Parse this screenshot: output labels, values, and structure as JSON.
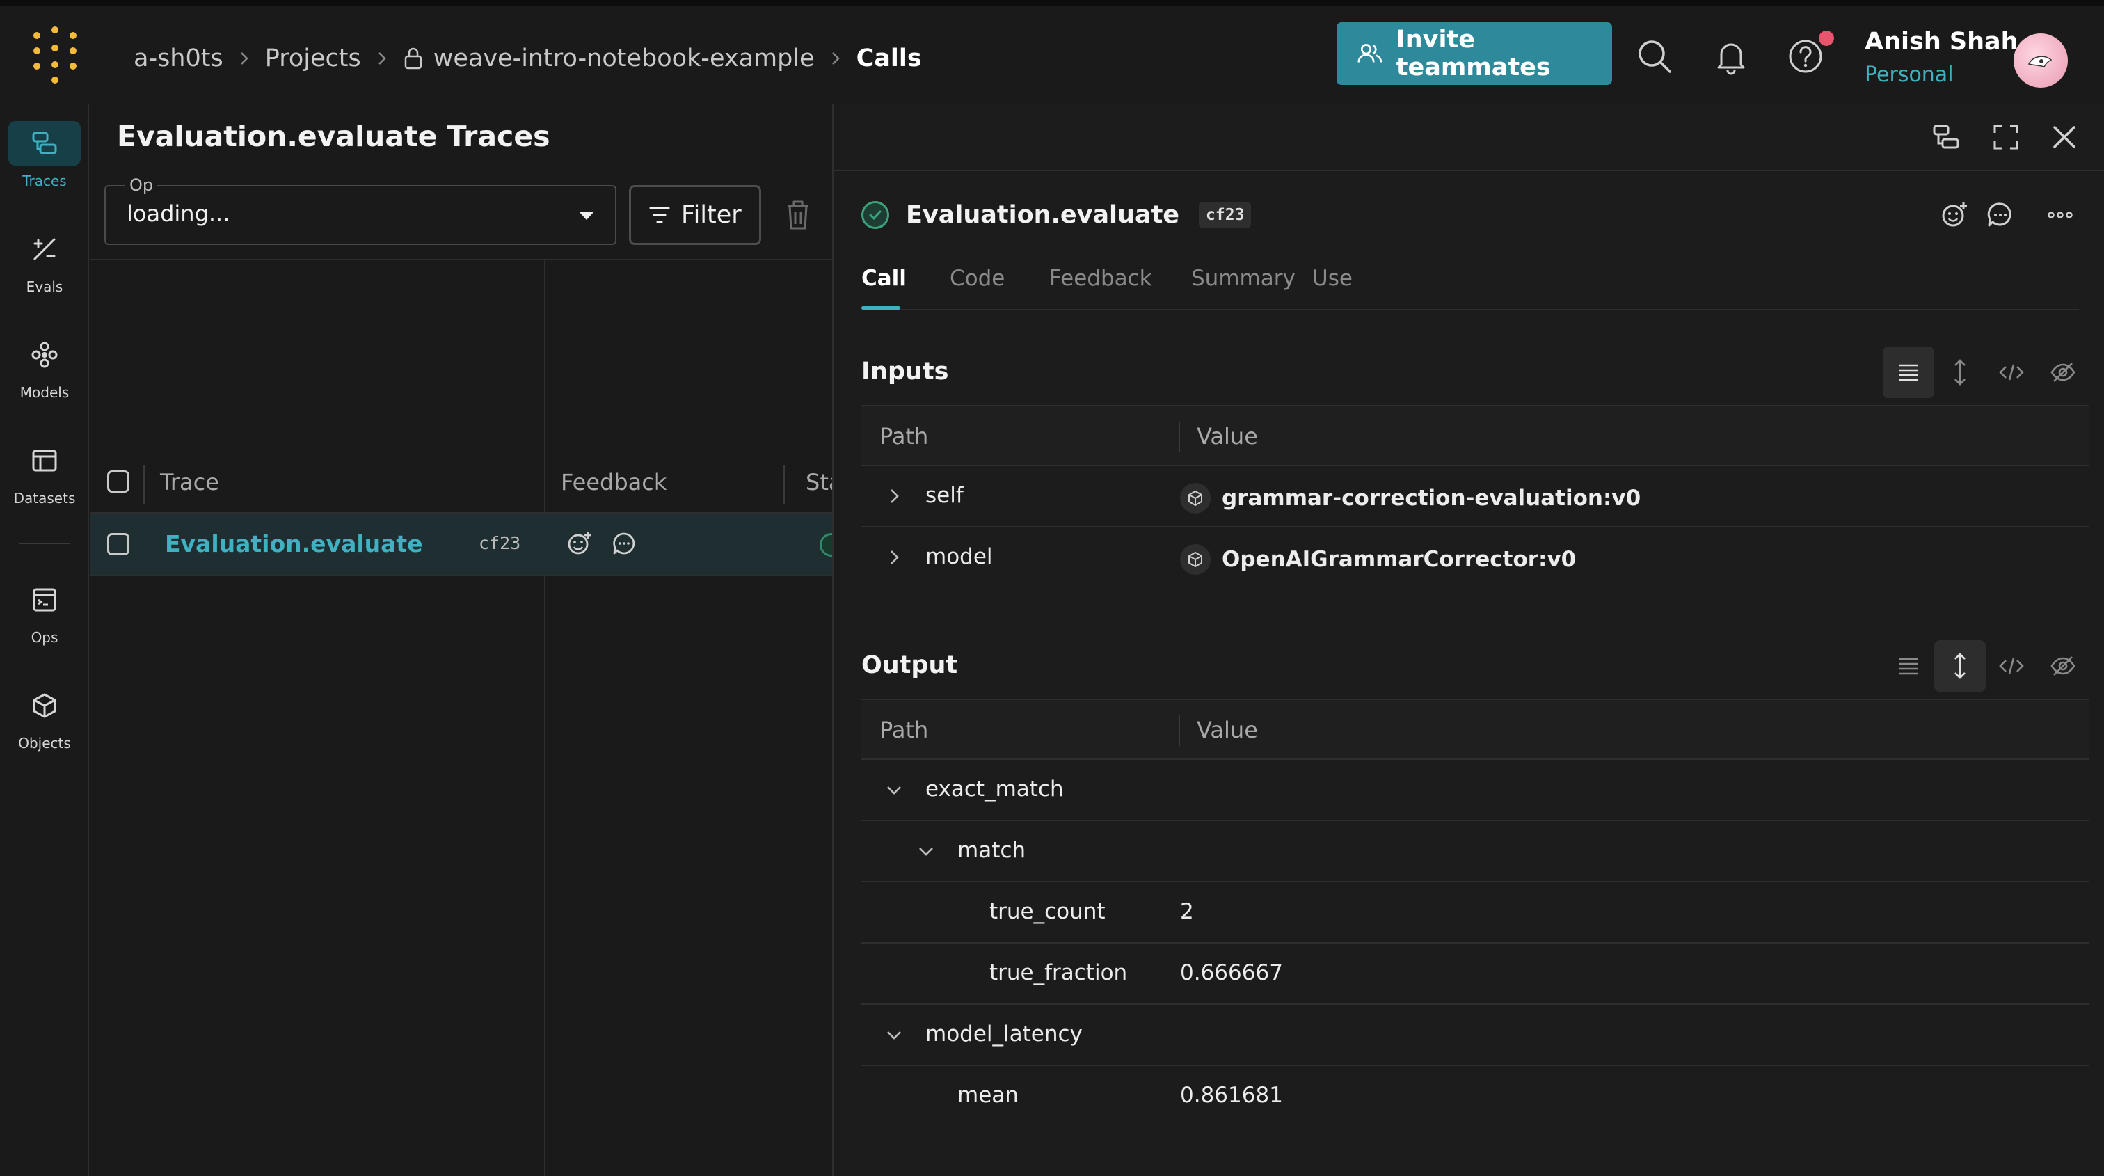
{
  "header": {
    "breadcrumb": [
      "a-sh0ts",
      "Projects",
      "weave-intro-notebook-example",
      "Calls"
    ],
    "invite_label": "Invite teammates",
    "user": {
      "name": "Anish Shah",
      "subtitle": "Personal"
    }
  },
  "sidebar": {
    "items": [
      {
        "label": "Traces",
        "icon": "traces-icon",
        "active": true
      },
      {
        "label": "Evals",
        "icon": "evals-icon",
        "active": false
      },
      {
        "label": "Models",
        "icon": "models-icon",
        "active": false
      },
      {
        "label": "Datasets",
        "icon": "datasets-icon",
        "active": false
      },
      {
        "label": "Ops",
        "icon": "ops-icon",
        "active": false
      },
      {
        "label": "Objects",
        "icon": "objects-icon",
        "active": false
      }
    ]
  },
  "traces": {
    "title": "Evaluation.evaluate Traces",
    "op_label": "Op",
    "op_value": "loading...",
    "filter_label": "Filter",
    "columns": [
      "Trace",
      "Feedback",
      "Sta"
    ],
    "rows": [
      {
        "name": "Evaluation.evaluate",
        "id": "cf23"
      }
    ]
  },
  "detail": {
    "title": "Evaluation.evaluate",
    "id": "cf23",
    "tabs": [
      "Call",
      "Code",
      "Feedback",
      "Summary",
      "Use"
    ],
    "active_tab": "Call",
    "inputs": {
      "title": "Inputs",
      "col_path": "Path",
      "col_value": "Value",
      "rows": [
        {
          "path": "self",
          "value": "grammar-correction-evaluation:v0"
        },
        {
          "path": "model",
          "value": "OpenAIGrammarCorrector:v0"
        }
      ]
    },
    "output": {
      "title": "Output",
      "col_path": "Path",
      "col_value": "Value",
      "rows": [
        {
          "path": "exact_match",
          "value": ""
        },
        {
          "path": "match",
          "value": ""
        },
        {
          "path": "true_count",
          "value": "2"
        },
        {
          "path": "true_fraction",
          "value": "0.666667"
        },
        {
          "path": "model_latency",
          "value": ""
        },
        {
          "path": "mean",
          "value": "0.861681"
        }
      ]
    }
  },
  "colors": {
    "accent": "#3fb1c1",
    "invite_bg": "#2e8a9a",
    "notify": "#e6556c"
  }
}
